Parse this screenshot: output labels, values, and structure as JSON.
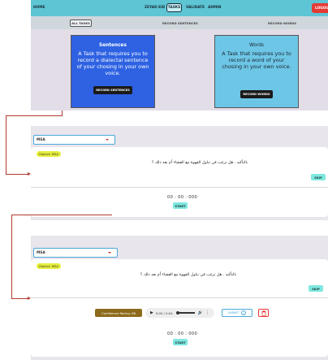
{
  "navbar": {
    "home": "HOME",
    "user": "ZEYAD EID",
    "tasks": "TASKS",
    "validate": "VALIDATE",
    "admin": "ADMIN",
    "logout": "LOGOU"
  },
  "tabs": {
    "all": "ALL TASKS",
    "sentences": "RECORD SENTENCES",
    "words": "RECORD WORDS"
  },
  "cards": {
    "sentences": {
      "title": "Sentences",
      "desc": "A Task that requires you to record a dialectal sentence of your chosing in your own voice.",
      "button": "RECORD SENTENCES"
    },
    "words": {
      "title": "Words",
      "desc": "A Task that requires you to record a word of your chosing in your own voice.",
      "button": "RECORD WORDS"
    }
  },
  "section1": {
    "select": "MSA",
    "dialect": "Dialect: MSA",
    "sentence": "بالتأكيد . هل ترغب في تناول القهوة مع العشاء أم بعد ذلك ؟",
    "skip": "SKIP",
    "timer": "00 : 00 : 000",
    "start": "START"
  },
  "section2": {
    "select": "MSA",
    "dialect": "Dialect: MSA",
    "sentence": "بالتأكيد . هل ترغب في تناول القهوة مع العشاء أم بعد ذلك ؟",
    "skip": "SKIP",
    "confidence": "Confidence Rating: 86",
    "player_time": "0:00 / 0:04",
    "submit": "SUBMIT",
    "timer": "00 : 00 : 000",
    "start": "START"
  },
  "colors": {
    "navbar": "#5dc5d4",
    "card_blue": "#2e62e3",
    "card_sky": "#6dc6e6",
    "accent_cyan": "#7fe8e0",
    "connector": "#b03a2e"
  }
}
